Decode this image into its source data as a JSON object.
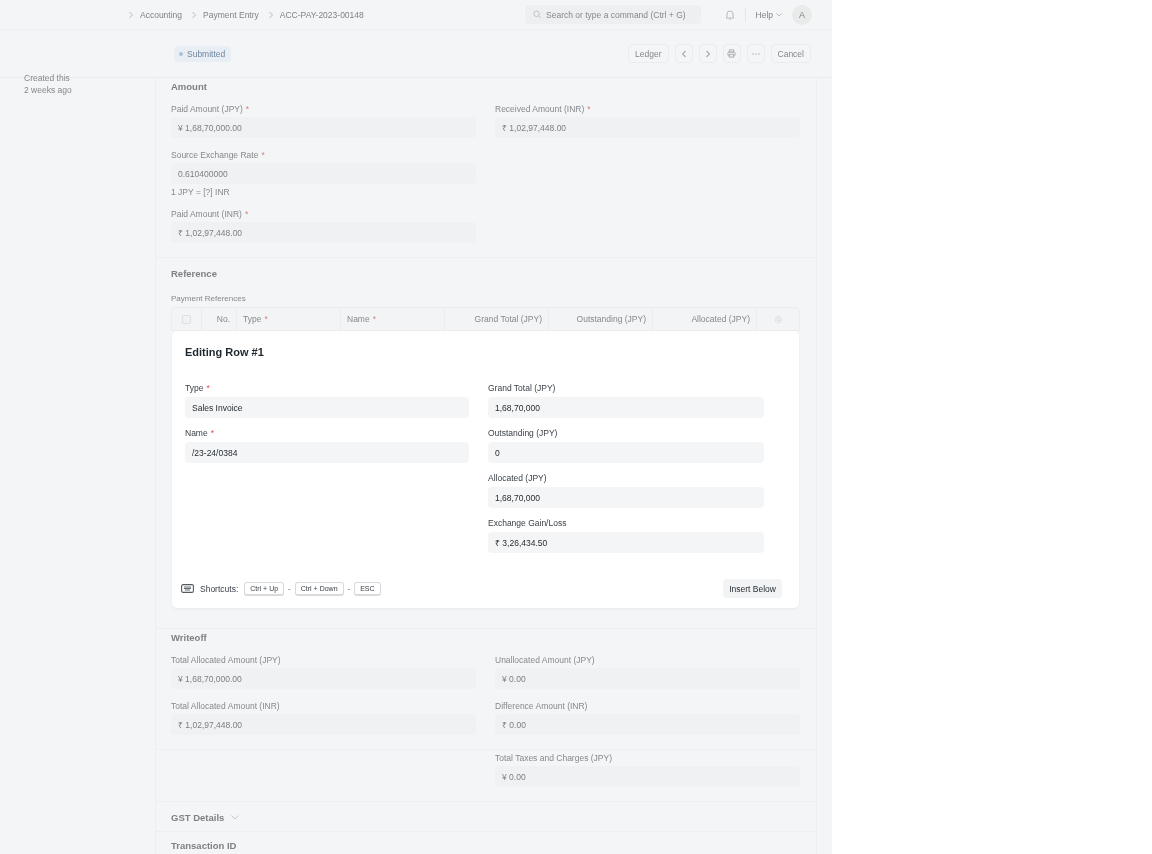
{
  "breadcrumbs": [
    "Accounting",
    "Payment Entry",
    "ACC-PAY-2023-00148"
  ],
  "search": {
    "placeholder": "Search or type a command (Ctrl + G)"
  },
  "help": "Help",
  "avatar": "A",
  "status": "Submitted",
  "actions": [
    {
      "kind": "text",
      "label": "Ledger"
    },
    {
      "kind": "prev"
    },
    {
      "kind": "next"
    },
    {
      "kind": "print"
    },
    {
      "kind": "more"
    },
    {
      "kind": "text",
      "label": "Cancel"
    }
  ],
  "sidebar": {
    "lines": [
      "Created this",
      "2 weeks ago"
    ]
  },
  "sections": [
    {
      "kind": "fields",
      "title": "Amount",
      "rows": [
        {
          "left": {
            "label": "Paid Amount (JPY)",
            "marker": "*",
            "value": "¥ 1,68,70,000.00"
          },
          "right": {
            "label": "Received Amount (INR)",
            "marker": "*",
            "value": "₹ 1,02,97,448.00"
          }
        },
        {
          "left": {
            "label": "Source Exchange Rate",
            "marker": "*",
            "value": "0.610400000",
            "description": "1 JPY = [?] INR"
          }
        },
        {
          "left": {
            "label": "Paid Amount (INR)",
            "marker": "*",
            "value": "₹ 1,02,97,448.00"
          }
        }
      ]
    },
    {
      "kind": "table",
      "title": "Reference",
      "table_label": "Payment References",
      "select_all": {
        "checked": false
      },
      "columns": [
        {
          "label": "No."
        },
        {
          "label": "Type",
          "marker": "*"
        },
        {
          "label": "Name",
          "marker": "*"
        },
        {
          "label": "Grand Total (JPY)"
        },
        {
          "label": "Outstanding (JPY)"
        },
        {
          "label": "Allocated (JPY)"
        }
      ],
      "dialog": {
        "title": "Editing Row #1",
        "left": [
          {
            "label": "Type",
            "marker": "*",
            "value": "Sales Invoice"
          },
          {
            "label": "Name",
            "marker": "*",
            "value": "/23-24/0384"
          }
        ],
        "right": [
          {
            "label": "Grand Total (JPY)",
            "value": "1,68,70,000"
          },
          {
            "label": "Outstanding (JPY)",
            "value": "0"
          },
          {
            "label": "Allocated (JPY)",
            "value": "1,68,70,000"
          },
          {
            "label": "Exchange Gain/Loss",
            "value": "₹ 3,26,434.50"
          }
        ],
        "shortcuts_label": "Shortcuts:",
        "keys": [
          "Ctrl + Up",
          "Ctrl + Down",
          "ESC"
        ],
        "separator": "-",
        "button": "Insert Below"
      }
    },
    {
      "kind": "fields",
      "title": "Writeoff",
      "rows": [
        {
          "left": {
            "label": "Total Allocated Amount (JPY)",
            "value": "¥ 1,68,70,000.00"
          },
          "right": {
            "label": "Unallocated Amount (JPY)",
            "value": "¥ 0.00"
          }
        },
        {
          "left": {
            "label": "Total Allocated Amount (INR)",
            "value": "₹ 1,02,97,448.00"
          },
          "right": {
            "label": "Difference Amount (INR)",
            "value": "₹ 0.00"
          }
        }
      ]
    },
    {
      "kind": "fields",
      "rows": [
        {
          "right": {
            "label": "Total Taxes and Charges (JPY)",
            "value": "¥ 0.00"
          }
        }
      ]
    },
    {
      "kind": "collapsible",
      "title": "GST Details",
      "expanded": false
    },
    {
      "kind": "fields",
      "title": "Transaction ID"
    }
  ]
}
